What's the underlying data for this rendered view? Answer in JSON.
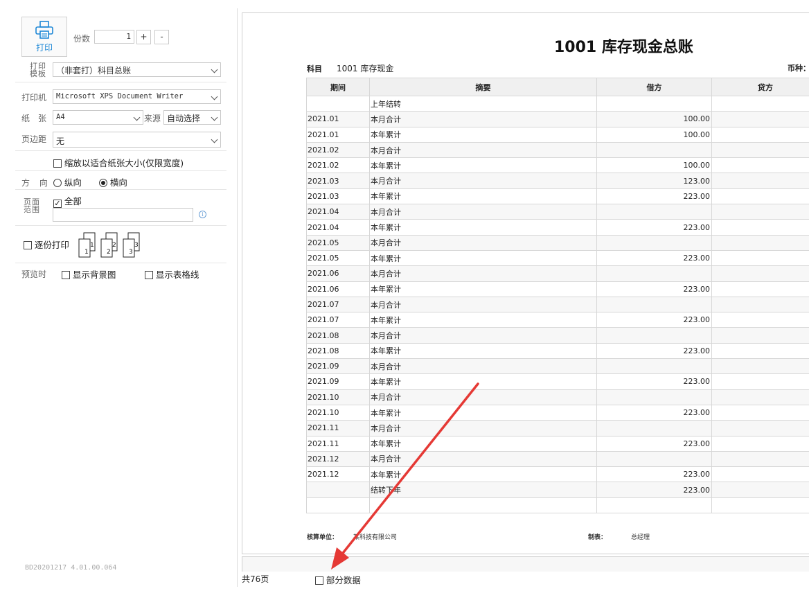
{
  "left_panel": {
    "print_label": "打印",
    "copies_label": "份数",
    "copies_value": "1",
    "plus_label": "+",
    "minus_label": "-",
    "template_label_line1": "打印",
    "template_label_line2": "模板",
    "template_value": "（非套打）科目总账",
    "printer_label": "打印机",
    "printer_value": "Microsoft XPS Document Writer",
    "paper_label": "纸 张",
    "paper_value": "A4",
    "source_label": "来源",
    "source_value": "自动选择",
    "margin_label": "页边距",
    "margin_value": "无",
    "fit_label": "缩放以适合纸张大小(仅限宽度)",
    "direction_label": "方 向",
    "portrait_label": "纵向",
    "landscape_label": "横向",
    "range_label_line1": "页面",
    "range_label_line2": "范围",
    "all_label": "全部",
    "info_glyph": "i",
    "collate_label": "逐份打印",
    "preview_label": "预览时",
    "show_bg_label": "显示背景图",
    "show_grid_label": "显示表格线",
    "version": "BD20201217 4.01.00.064"
  },
  "sheet": {
    "title": "1001 库存现金总账",
    "subject_key": "科目",
    "subject_value": "1001 库存现金",
    "currency_key": "币种：",
    "headers": [
      "期间",
      "摘要",
      "借方",
      "贷方"
    ],
    "rows": [
      [
        "",
        "上年结转",
        ""
      ],
      [
        "2021.01",
        "本月合计",
        "100.00"
      ],
      [
        "2021.01",
        "本年累计",
        "100.00"
      ],
      [
        "2021.02",
        "本月合计",
        ""
      ],
      [
        "2021.02",
        "本年累计",
        "100.00"
      ],
      [
        "2021.03",
        "本月合计",
        "123.00"
      ],
      [
        "2021.03",
        "本年累计",
        "223.00"
      ],
      [
        "2021.04",
        "本月合计",
        ""
      ],
      [
        "2021.04",
        "本年累计",
        "223.00"
      ],
      [
        "2021.05",
        "本月合计",
        ""
      ],
      [
        "2021.05",
        "本年累计",
        "223.00"
      ],
      [
        "2021.06",
        "本月合计",
        ""
      ],
      [
        "2021.06",
        "本年累计",
        "223.00"
      ],
      [
        "2021.07",
        "本月合计",
        ""
      ],
      [
        "2021.07",
        "本年累计",
        "223.00"
      ],
      [
        "2021.08",
        "本月合计",
        ""
      ],
      [
        "2021.08",
        "本年累计",
        "223.00"
      ],
      [
        "2021.09",
        "本月合计",
        ""
      ],
      [
        "2021.09",
        "本年累计",
        "223.00"
      ],
      [
        "2021.10",
        "本月合计",
        ""
      ],
      [
        "2021.10",
        "本年累计",
        "223.00"
      ],
      [
        "2021.11",
        "本月合计",
        ""
      ],
      [
        "2021.11",
        "本年累计",
        "223.00"
      ],
      [
        "2021.12",
        "本月合计",
        ""
      ],
      [
        "2021.12",
        "本年累计",
        "223.00"
      ],
      [
        "",
        "结转下年",
        "223.00"
      ],
      [
        "",
        "",
        ""
      ]
    ],
    "footer_unit_key": "核算单位：",
    "footer_unit_value": "某科技有限公司",
    "footer_maker_key": "制表：",
    "footer_maker_value": "总经理"
  },
  "status": {
    "page_count": "共76页",
    "partial_label": "部分数据"
  },
  "colors": {
    "accent": "#1e88d6",
    "annotation_arrow": "#e53935"
  }
}
